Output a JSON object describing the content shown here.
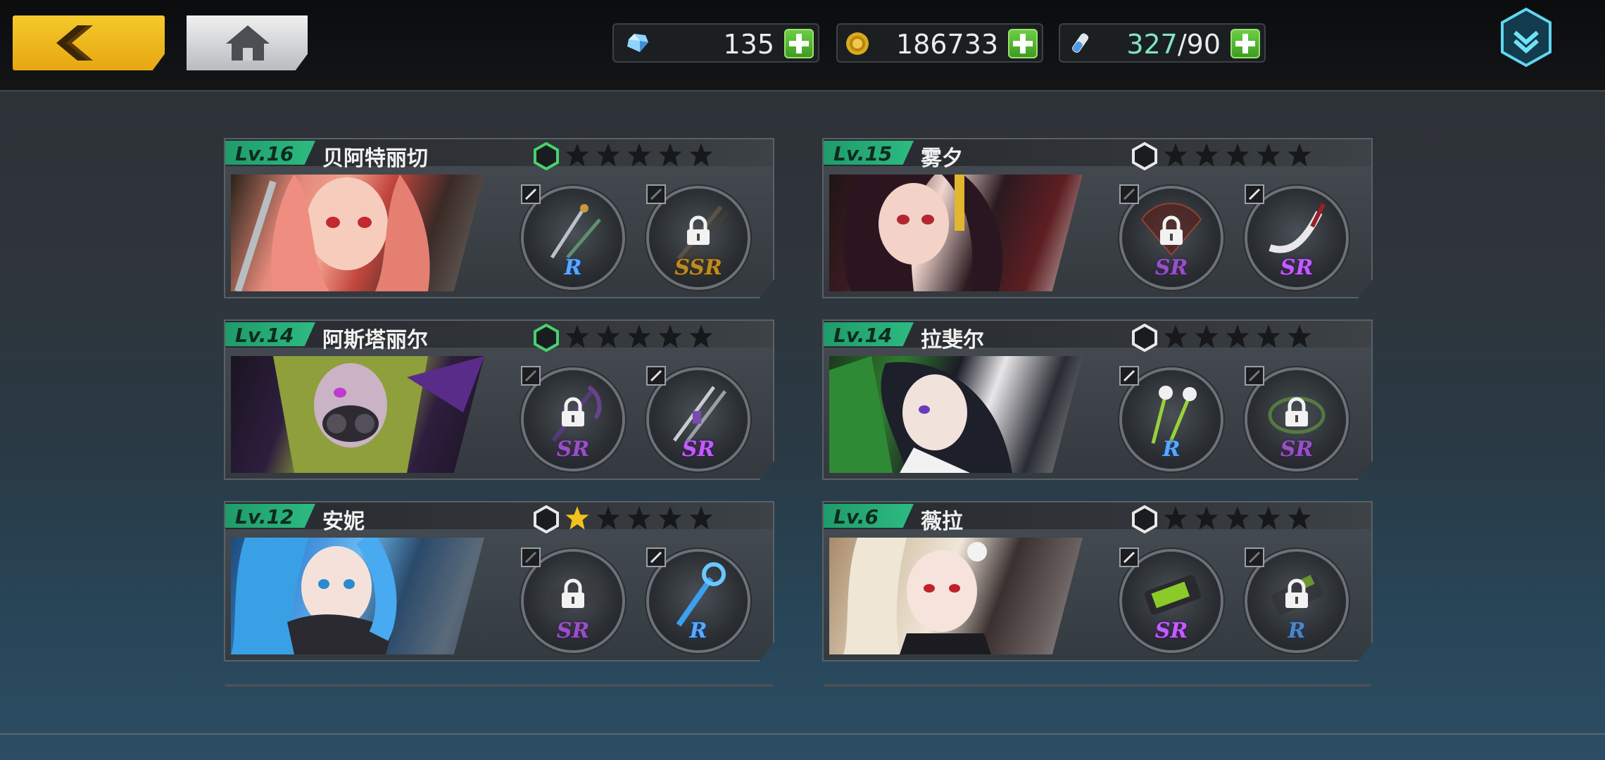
{
  "topbar": {
    "resources": [
      {
        "icon": "gem-icon",
        "value": "135"
      },
      {
        "icon": "gold-coin-icon",
        "value": "186733"
      },
      {
        "icon": "stamina-vial-icon",
        "current": "327",
        "max": "/90"
      }
    ]
  },
  "cards": [
    {
      "level": "Lv.16",
      "name": "贝阿特丽切",
      "awaken": "green",
      "stars_filled": 0,
      "stars_total": 5,
      "weapons": [
        {
          "rarity": "R",
          "locked": false
        },
        {
          "rarity": "SSR",
          "locked": true
        }
      ]
    },
    {
      "level": "Lv.15",
      "name": "雾夕",
      "awaken": "white",
      "stars_filled": 0,
      "stars_total": 5,
      "weapons": [
        {
          "rarity": "SR",
          "locked": true
        },
        {
          "rarity": "SR",
          "locked": false
        }
      ]
    },
    {
      "level": "Lv.14",
      "name": "阿斯塔丽尔",
      "awaken": "green",
      "stars_filled": 0,
      "stars_total": 5,
      "weapons": [
        {
          "rarity": "SR",
          "locked": true
        },
        {
          "rarity": "SR",
          "locked": false
        }
      ]
    },
    {
      "level": "Lv.14",
      "name": "拉斐尔",
      "awaken": "white",
      "stars_filled": 0,
      "stars_total": 5,
      "weapons": [
        {
          "rarity": "R",
          "locked": false
        },
        {
          "rarity": "SR",
          "locked": true
        }
      ]
    },
    {
      "level": "Lv.12",
      "name": "安妮",
      "awaken": "white",
      "stars_filled": 1,
      "stars_total": 5,
      "weapons": [
        {
          "rarity": "SR",
          "locked": true
        },
        {
          "rarity": "R",
          "locked": false
        }
      ]
    },
    {
      "level": "Lv.6",
      "name": "薇拉",
      "awaken": "white",
      "stars_filled": 0,
      "stars_total": 5,
      "weapons": [
        {
          "rarity": "SR",
          "locked": false
        },
        {
          "rarity": "R",
          "locked": true
        }
      ]
    }
  ],
  "colors": {
    "level_badge": "#2dbb82",
    "back_button": "#f2c11f",
    "plus_button": "#4fb42d",
    "star_gold": "#f3c21a"
  }
}
